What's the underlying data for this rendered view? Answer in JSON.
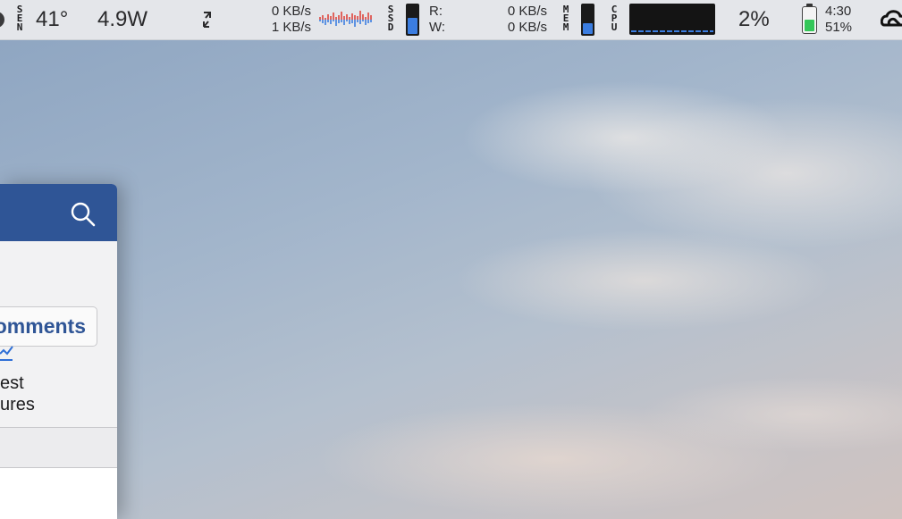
{
  "menubar": {
    "sensors_label": [
      "S",
      "E",
      "N"
    ],
    "temperature": "41°",
    "power": "4.9W",
    "network": {
      "down": "0 KB/s",
      "up": "1 KB/s"
    },
    "ssd_label": [
      "S",
      "S",
      "D"
    ],
    "ssd_fill_percent": 55,
    "disk": {
      "read_label": "R:",
      "write_label": "W:",
      "read": "0 KB/s",
      "write": "0 KB/s"
    },
    "mem_label": [
      "M",
      "E",
      "M"
    ],
    "mem_fill_percent": 38,
    "cpu_label": [
      "C",
      "P",
      "U"
    ],
    "cpu_percent": "2%",
    "battery": {
      "time": "4:30",
      "percent": "51%",
      "level": 51
    },
    "colors": {
      "graph_red": "#e0443a",
      "graph_blue": "#3b7de0",
      "battery_green": "#34c759"
    },
    "icons": [
      "sensor-icon",
      "arrows-diagonal-icon",
      "network-graph-icon",
      "ssd-bar-icon",
      "mem-bar-icon",
      "cpu-graph-icon",
      "battery-icon",
      "creative-cloud-icon"
    ]
  },
  "window": {
    "header_color": "#2f5596",
    "comments_button": "omments",
    "lines": [
      "est",
      "ures"
    ],
    "icons": [
      "search-icon",
      "chart-icon"
    ]
  }
}
